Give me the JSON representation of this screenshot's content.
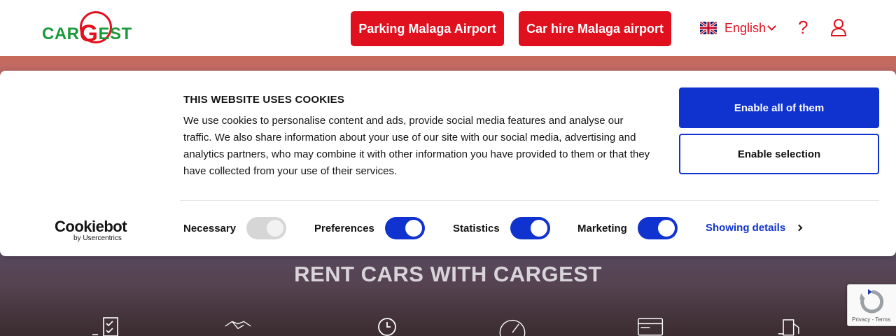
{
  "header": {
    "logo_text_before": "CAR",
    "logo_text_g": "G",
    "logo_text_after": "EST",
    "parking_button": "Parking Malaga Airport",
    "car_hire_button": "Car hire Malaga airport",
    "language": "English",
    "help_icon": "?"
  },
  "hero": {
    "title": "RENT CARS WITH CARGEST",
    "feature_icons": [
      "checklist-icon",
      "handshake-icon",
      "clock-icon",
      "speedometer-icon",
      "credit-card-icon",
      "gas-pump-icon"
    ]
  },
  "cookie_banner": {
    "title": "THIS WEBSITE USES COOKIES",
    "body": "We use cookies to personalise content and ads, provide social media features and analyse our traffic. We also share information about your use of our site with our social media, advertising and analytics partners, who may combine it with other information you have provided to them or that they have collected from your use of their services.",
    "enable_all": "Enable all of them",
    "enable_selection": "Enable selection",
    "provider_name": "Cookiebot",
    "provider_sub": "by Usercentrics",
    "toggles": [
      {
        "label": "Necessary",
        "state": "on-disabled"
      },
      {
        "label": "Preferences",
        "state": "on"
      },
      {
        "label": "Statistics",
        "state": "on"
      },
      {
        "label": "Marketing",
        "state": "on"
      }
    ],
    "details_link": "Showing details"
  },
  "recaptcha": {
    "terms": "Privacy - Terms"
  },
  "colors": {
    "brand_red": "#e1101f",
    "brand_green": "#1a9a3a",
    "cookie_blue": "#1032cf"
  }
}
